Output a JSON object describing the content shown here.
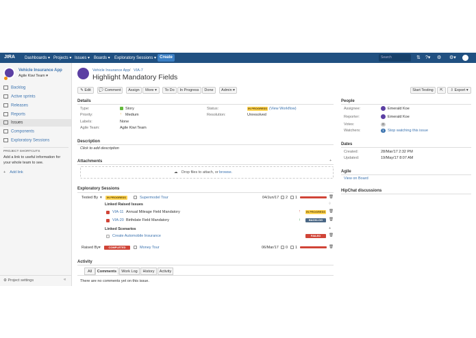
{
  "topnav": {
    "logo": "JIRA",
    "items": [
      "Dashboards ▾",
      "Projects ▾",
      "Issues ▾",
      "Boards ▾",
      "Exploratory Sessions ▾"
    ],
    "create": "Create",
    "search_placeholder": "Search"
  },
  "sidebar": {
    "project_name": "Vehicle Insurance App",
    "team": "Agile Kiwi Team ▾",
    "items": [
      "Backlog",
      "Active sprints",
      "Releases",
      "Reports",
      "Issues",
      "Components",
      "Exploratory Sessions"
    ],
    "shortcuts_title": "PROJECT SHORTCUTS",
    "shortcuts_text_1": "Add a link to useful information for",
    "shortcuts_text_2": "your whole team to see.",
    "add_link": "Add link",
    "project_settings": "Project settings",
    "collapse": "«"
  },
  "issue": {
    "breadcrumb_project": "Vehicle Insurance App",
    "breadcrumb_sep": "/",
    "breadcrumb_key": "VIA-7",
    "title": "Highlight Mandatory Fields"
  },
  "toolbar": {
    "edit": "✎ Edit",
    "comment": "💬 Comment",
    "assign": "Assign",
    "more": "More ▾",
    "todo": "To Do",
    "in_progress": "In Progress",
    "done": "Done",
    "admin": "Admin ▾",
    "start_testing": "Start Testing",
    "share": "⇱",
    "export": "⇩ Export ▾"
  },
  "details": {
    "heading": "Details",
    "type_label": "Type:",
    "type_value": "Story",
    "priority_label": "Priority:",
    "priority_value": "Medium",
    "labels_label": "Labels:",
    "labels_value": "None",
    "team_label": "Agile Team:",
    "team_value": "Agile Kiwi Team",
    "status_label": "Status:",
    "status_value": "IN PROGRESS",
    "status_link": "(View Workflow)",
    "resolution_label": "Resolution:",
    "resolution_value": "Unresolved"
  },
  "description": {
    "heading": "Description",
    "placeholder": "Click to add description"
  },
  "attachments": {
    "heading": "Attachments",
    "drop_text": "Drop files to attach, or",
    "browse": "browse."
  },
  "sessions": {
    "heading": "Exploratory Sessions",
    "tested_by": "Tested By",
    "s1_status": "IN PROGRESS",
    "s1_name": "Supermodel Tour",
    "s1_date": "04/Jun/17",
    "s1_count_a": "2",
    "s1_count_b": "1",
    "linked_issues_heading": "Linked Raised Issues",
    "issue1_key": "VIA-11",
    "issue1_name": "Annual Mileage Field Mandatory",
    "issue1_status": "IN PROGRESS",
    "issue2_key": "VIA-20",
    "issue2_name": "Birthdate Field Mandatory",
    "issue2_status": "BACKLOG",
    "linked_scenarios_heading": "Linked Scenarios",
    "scenario_name": "Create Automobile Insurance",
    "scenario_status": "FAILED",
    "raised_by": "Raised By",
    "s2_status": "COMPLETED",
    "s2_name": "Money Tour",
    "s2_date": "06/Mar/17",
    "s2_count_a": "0",
    "s2_count_b": "1"
  },
  "activity": {
    "heading": "Activity",
    "tabs": [
      "All",
      "Comments",
      "Work Log",
      "History",
      "Activity"
    ],
    "empty": "There are no comments yet on this issue."
  },
  "people": {
    "heading": "People",
    "assignee_label": "Assignee:",
    "assignee": "Emerald Koe",
    "reporter_label": "Reporter:",
    "reporter": "Emerald Koe",
    "votes_label": "Votes:",
    "votes": "0",
    "watchers_label": "Watchers:",
    "watchers_count": "1",
    "watch_link": "Stop watching this issue"
  },
  "dates": {
    "heading": "Dates",
    "created_label": "Created:",
    "created": "28/Mar/17 2:32 PM",
    "updated_label": "Updated:",
    "updated": "19/May/17 8:07 AM"
  },
  "agile": {
    "heading": "Agile",
    "link": "View on Board"
  },
  "hipchat": {
    "heading": "HipChat discussions"
  },
  "colors": {
    "nav": "#205081",
    "link": "#3b73af",
    "inprogress": "#ffd351",
    "complete": "#d04437",
    "backlog": "#4a6785"
  }
}
